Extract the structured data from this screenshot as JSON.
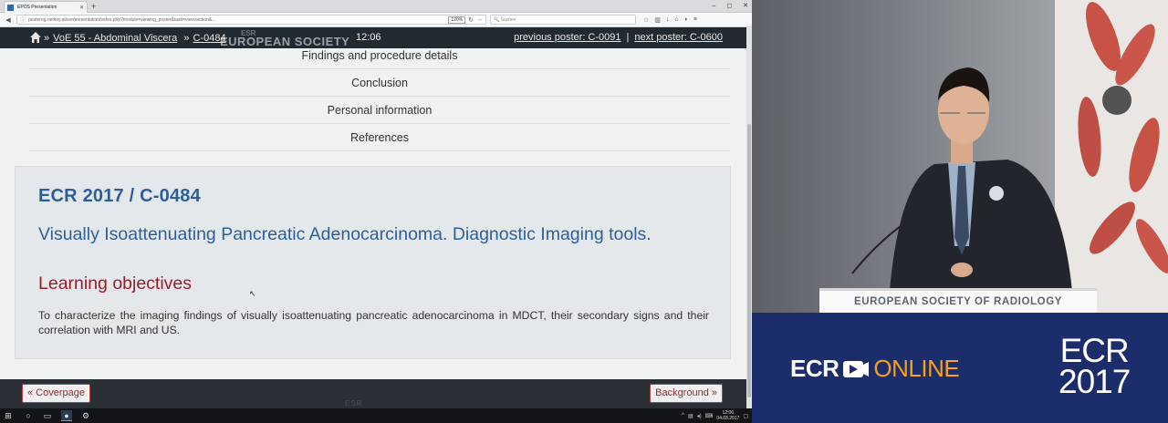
{
  "browser": {
    "tab_title": "EPOS Presentation",
    "new_tab": "+",
    "window_controls": [
      "–",
      "◻",
      "✕"
    ],
    "url": "posterng.netkey.at/esr/presentation/index.php?module=viewing_poster&task=viewsection&...",
    "zoom": "120%",
    "search_placeholder": "Suchen"
  },
  "header": {
    "breadcrumb": [
      {
        "label": "VoE 55 - Abdominal Viscera"
      },
      {
        "label": "C-0484"
      }
    ],
    "time": "12:06",
    "watermark": "EUROPEAN SOCIETY",
    "watermark_top": "ESR",
    "previous_poster": "previous poster: C-0091",
    "separator": "|",
    "next_poster": "next poster: C-0600"
  },
  "sections": [
    "Findings and procedure details",
    "Conclusion",
    "Personal information",
    "References"
  ],
  "poster": {
    "id": "ECR 2017 / C-0484",
    "title": "Visually Isoattenuating Pancreatic Adenocarcinoma. Diagnostic Imaging tools.",
    "section_heading": "Learning objectives",
    "text": "To characterize the imaging findings of visually isoattenuating pancreatic adenocarcinoma in MDCT, their secondary signs and their correlation with MRI and US."
  },
  "footer": {
    "prev_label": "« Coverpage",
    "next_label": "Background »",
    "watermark": "ESR"
  },
  "taskbar": {
    "time": "12:06",
    "date": "04.03.2017"
  },
  "video": {
    "podium_text": "EUROPEAN SOCIETY OF RADIOLOGY"
  },
  "branding": {
    "ecr": "ECR",
    "online": "ONLINE",
    "event_name": "ECR",
    "event_year": "2017"
  },
  "colors": {
    "header_bar": "#222a31",
    "title_blue": "#2c5f9a",
    "section_red": "#9a1c2c",
    "brand_navy": "#1c2d6b",
    "brand_orange": "#f7a01b"
  }
}
